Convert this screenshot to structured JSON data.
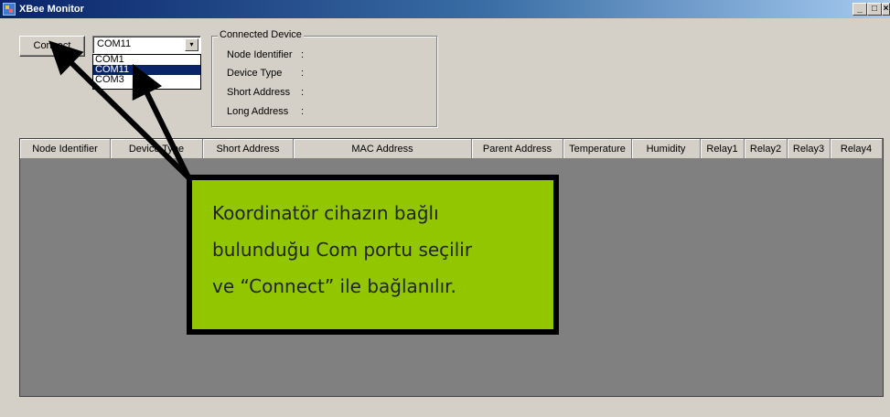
{
  "window": {
    "title": "XBee Monitor",
    "minimize": "_",
    "maximize": "□",
    "close": "×"
  },
  "toolbar": {
    "connect_label": "Connect",
    "port_value": "COM11",
    "dropdown_glyph": "▾"
  },
  "port_options": [
    "COM1",
    "COM11",
    "COM3"
  ],
  "connected_device": {
    "legend": "Connected Device",
    "fields": [
      {
        "label": "Node Identifier",
        "value": ":"
      },
      {
        "label": "Device Type",
        "value": ":"
      },
      {
        "label": "Short Address",
        "value": ":"
      },
      {
        "label": "Long Address",
        "value": ":"
      }
    ]
  },
  "table": {
    "columns": [
      "Node Identifier",
      "Device Type",
      "Short Address",
      "MAC Address",
      "Parent Address",
      "Temperature",
      "Humidity",
      "Relay1",
      "Relay2",
      "Relay3",
      "Relay4"
    ]
  },
  "callout": {
    "lines": [
      "Koordinatör cihazın bağlı",
      "bulunduğu Com portu seçilir",
      "ve “Connect” ile bağlanılır."
    ]
  },
  "colors": {
    "callout_bg": "#92c700",
    "grid_bg": "#808080",
    "selection": "#0a246a"
  }
}
